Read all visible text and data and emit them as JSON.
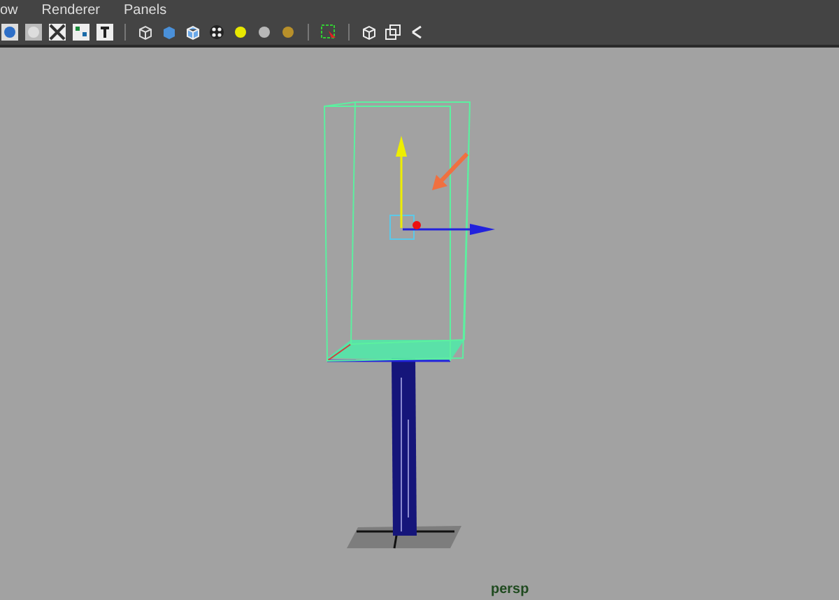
{
  "menu_bar": {
    "items": [
      {
        "label": "ow"
      },
      {
        "label": "Renderer"
      },
      {
        "label": "Panels"
      }
    ]
  },
  "viewport": {
    "camera_label": "persp"
  }
}
